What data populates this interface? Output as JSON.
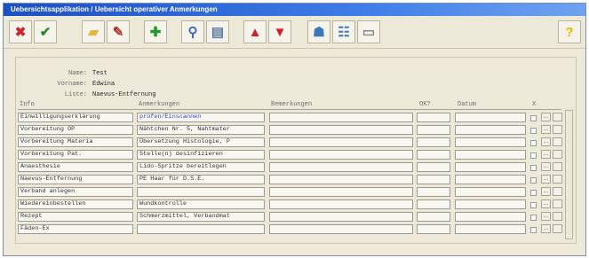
{
  "window": {
    "title": "Uebersichtsapplikation / Uebersicht operativer Anmerkungen"
  },
  "toolbar": {
    "buttons": [
      {
        "name": "delete-icon",
        "glyph": "✖",
        "color": "#c8282e"
      },
      {
        "name": "checkmark-icon",
        "glyph": "✔",
        "color": "#2a8a2a"
      },
      {
        "name": "folder-icon",
        "glyph": "▰",
        "color": "#e2b642"
      },
      {
        "name": "clipboard-icon",
        "glyph": "✎",
        "color": "#b03030"
      },
      {
        "name": "plus-icon",
        "glyph": "✚",
        "color": "#1f9a2c"
      },
      {
        "name": "search-icon",
        "glyph": "⚲",
        "color": "#3a6ab8"
      },
      {
        "name": "print-icon",
        "glyph": "▤",
        "color": "#5a7aa8"
      },
      {
        "name": "arrow-up-icon",
        "glyph": "▲",
        "color": "#d0202a"
      },
      {
        "name": "arrow-down-icon",
        "glyph": "▼",
        "color": "#d0202a"
      },
      {
        "name": "user-icon",
        "glyph": "☗",
        "color": "#3a7ab8"
      },
      {
        "name": "users-icon",
        "glyph": "☷",
        "color": "#3a7ab8"
      },
      {
        "name": "document-icon",
        "glyph": "▭",
        "color": "#8a8a8a"
      },
      {
        "name": "help-icon",
        "glyph": "?",
        "color": "#e6b800"
      }
    ]
  },
  "patient": {
    "name_label": "Name:",
    "name": "Test",
    "vorname_label": "Vorname:",
    "vorname": "Edwina",
    "liste_label": "Liste:",
    "liste": "Naevus-Entfernung"
  },
  "columns": [
    "Info",
    "Anmerkungen",
    "Bemerkungen",
    "OK?",
    "Datum",
    "X"
  ],
  "rows": [
    {
      "info": "Einwilligungserklärung",
      "anm": "prüfen/Einscannen",
      "blue": true
    },
    {
      "info": "Vorbereitung OP",
      "anm": "Nähtchen Nr. 5, Nahtmater",
      "blue": false
    },
    {
      "info": "Vorbereitung Materia",
      "anm": "Übersetzung Histologie, P",
      "blue": false
    },
    {
      "info": "Vorbereitung Pat.",
      "anm": "Stelle(n) desinfizieren",
      "blue": false
    },
    {
      "info": "Anaesthesie",
      "anm": "Lido-Spritze bereitlegen",
      "blue": false
    },
    {
      "info": "Naevus-Entfernung",
      "anm": "PE Haar für D.S.E.",
      "blue": false
    },
    {
      "info": "Verband anlegen",
      "anm": "",
      "blue": false
    },
    {
      "info": "Wiedereinbestellen",
      "anm": "Wundkontrolle",
      "blue": false
    },
    {
      "info": "Rezept",
      "anm": "Schmerzmittel, Verbandmat",
      "blue": false
    },
    {
      "info": "Fäden-Ex",
      "anm": "",
      "blue": false
    }
  ]
}
